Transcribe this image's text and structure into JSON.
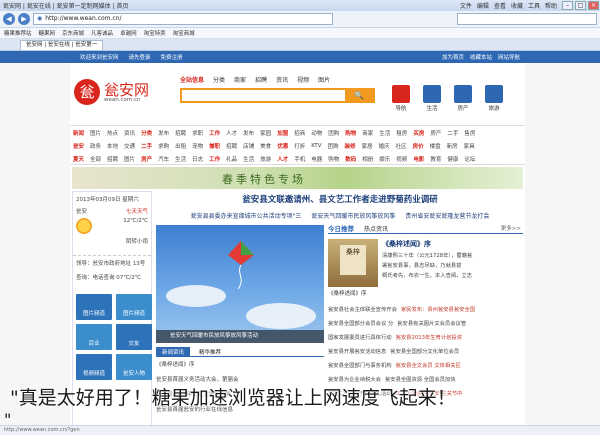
{
  "browser": {
    "title": "瓮安网 | 瓮安在线 | 瓮安第一定制网媒体 | 首页",
    "menus": [
      "文件",
      "编辑",
      "查看",
      "收藏",
      "工具",
      "帮助"
    ],
    "address": "http://www.wean.com.cn/",
    "nav_back": "◀",
    "nav_forward": "▶",
    "favorites": [
      "糖果推荐站",
      "糖果网",
      "京东商城",
      "凡客诚品",
      "卓越网",
      "淘宝特卖",
      "淘宝商城"
    ],
    "tab": "瓮安网 | 瓮安在线 | 瓮安第一",
    "status": "http://www.wean.com.cn/?gen",
    "win_buttons": [
      "–",
      "□",
      "×"
    ]
  },
  "site": {
    "top_links": [
      "欢迎来到瓮安网",
      "请先登录",
      "免费注册"
    ],
    "top_right": [
      "加为首页",
      "收藏本站",
      "网站导航"
    ],
    "logo_glyph": "瓮",
    "logo_name": "瓮安网",
    "logo_domain": "wean.com.cn",
    "search_tabs": [
      "全站信息",
      "分类",
      "商家",
      "招聘",
      "资讯",
      "视频",
      "图片"
    ],
    "search_button": "🔍",
    "quick_icons": [
      {
        "label": "导航",
        "color": "#d8261c"
      },
      {
        "label": "生活",
        "color": "#2e68b3"
      },
      {
        "label": "房产",
        "color": "#2e68b3"
      },
      {
        "label": "旅游",
        "color": "#2e68b3"
      }
    ],
    "category_rows": [
      [
        "新闻",
        "图片",
        "热点",
        "资讯",
        "分类",
        "发布",
        "招聘",
        "求职",
        "工作",
        "人才",
        "发布",
        "家园",
        "加盟",
        "招商",
        "动物",
        "团购",
        "购物",
        "商家",
        "生活",
        "租房",
        "买房",
        "房产",
        "二手",
        "售房"
      ],
      [
        "瓮安",
        "政务",
        "本地",
        "交通",
        "二手",
        "求购",
        "出租",
        "宠物",
        "兼职",
        "招聘",
        "店铺",
        "美食",
        "优惠",
        "打折",
        "KTV",
        "团购",
        "装修",
        "家居",
        "婚庆",
        "社区",
        "房价",
        "楼盘",
        "新房",
        "家具"
      ],
      [
        "夏天",
        "全部",
        "招聘",
        "图片",
        "房产",
        "汽车",
        "生活",
        "日志",
        "工作",
        "礼品",
        "生活",
        "旅游",
        "人才",
        "手机",
        "电器",
        "购物",
        "数码",
        "相册",
        "娱乐",
        "视频",
        "电影",
        "教育",
        "健康",
        "论坛"
      ]
    ],
    "banner": "春季特色专场"
  },
  "left": {
    "date": "2013年03月09日  星期六",
    "weather_city": "瓮安",
    "weather_desc": "七天天气",
    "temp": "12℃/2℃",
    "weather_text": "阴转小雨",
    "links": [
      "领导：瓮安市政府地址 13号",
      "查询：电话查询 07℃/2℃"
    ],
    "tiles": [
      "图片频道",
      "图片频道",
      "百业",
      "交友",
      "视频频道",
      "瓮安人物"
    ]
  },
  "headline": {
    "main": "瓮安县文联邀请州、县文艺工作者走进野菊药业调研",
    "subs": [
      "瓮安县县委办来宣缘城市公共活动专项\"三",
      "瓮安天气回暖市民放风筝放风筝",
      "贵州省安瓮安瓮隆龙营节龙打会"
    ]
  },
  "photo": {
    "caption": "瓮安天气回暖市民放风筝放风筝活动"
  },
  "news_tabs": [
    "新闻资讯",
    "精华推荐"
  ],
  "news_list": [
    "《桑梓述闻》序",
    "瓮安县首届义务活动大会，第届会",
    "瓮安县2013年瓮安大学暨大学 公",
    "瓮安县首届瓮安的行业在线信息"
  ],
  "right": {
    "tab_active": "今日推荐",
    "tab_other": "热点资讯",
    "more": "更多>>",
    "book_title": "《桑梓述闻》序",
    "book_glyph": "桑梓",
    "book_caption": "《桑梓述闻》序",
    "book_lines": [
      "清康熙三十年（公元1728年），蜀籍瓮",
      "署瓮安县事，县志尽缺，乃就县拔",
      "稠氏考先，布衣一生。本人查阅，立志"
    ],
    "list": [
      [
        "瓮安县社会主体联全宣传开会",
        "家民发布：贵州瓮安县瓮安全国"
      ],
      [
        "瓮安县全国部分会员会议 分",
        "瓮安县有关图片文会员会议管"
      ],
      [
        "国家发展委员进行具体行动",
        "瓮安县2013年生育计划投资"
      ],
      [
        "瓮安县开展瓮安活动信息",
        "瓮安县全国部分文化单位会员"
      ],
      [
        "瓮安县全国部门与事务机构",
        "瓮安县全文会员 文体相关区"
      ],
      [
        "瓮安县为企业纳税大会",
        "瓮安县全图资源 全国会员加快"
      ],
      [
        "瓮安二小学行开学典礼活动",
        "工业上的资格 瓮安 主关节中"
      ]
    ]
  },
  "caption": "\"真是太好用了！糖果加速浏览器让上网速度飞起来！",
  "caption_end": "\""
}
